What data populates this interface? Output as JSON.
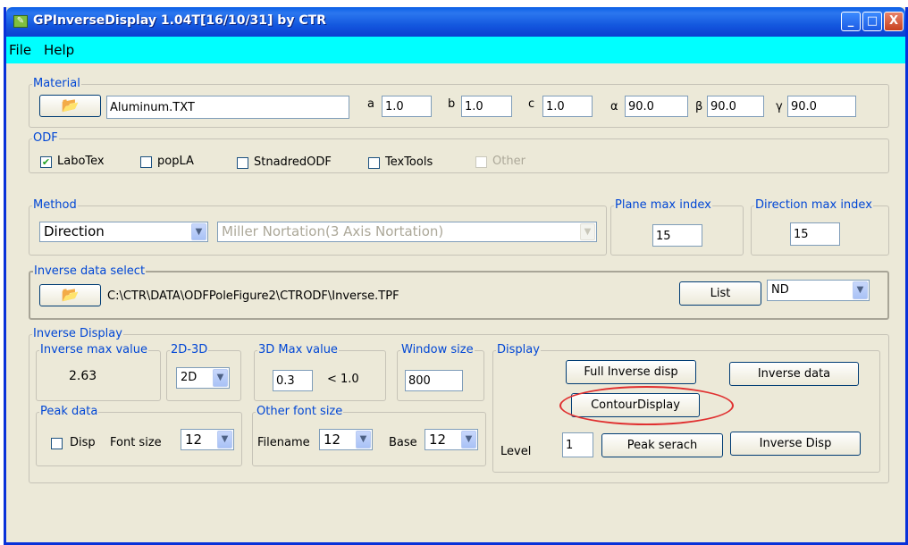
{
  "window": {
    "title": "GPInverseDisplay 1.04T[16/10/31] by CTR",
    "minimize": "_",
    "maximize": "□",
    "close": "X"
  },
  "menu": [
    "File",
    "Help"
  ],
  "material": {
    "legend": "Material",
    "file": "Aluminum.TXT",
    "params": [
      {
        "label": "a",
        "value": "1.0"
      },
      {
        "label": "b",
        "value": "1.0"
      },
      {
        "label": "c",
        "value": "1.0"
      },
      {
        "label": "α",
        "value": "90.0"
      },
      {
        "label": "β",
        "value": "90.0"
      },
      {
        "label": "γ",
        "value": "90.0"
      }
    ]
  },
  "odf": {
    "legend": "ODF",
    "options": [
      {
        "label": "LaboTex",
        "checked": true
      },
      {
        "label": "popLA",
        "checked": false
      },
      {
        "label": "StnadredODF",
        "checked": false
      },
      {
        "label": "TexTools",
        "checked": false
      },
      {
        "label": "Other",
        "checked": false
      }
    ]
  },
  "method": {
    "legend": "Method",
    "selected": "Direction",
    "notation": "Miller Nortation(3 Axis Nortation)"
  },
  "plane_max": {
    "legend": "Plane max index",
    "value": "15"
  },
  "direction_max": {
    "legend": "Direction max index",
    "value": "15"
  },
  "inverse_select": {
    "legend": "Inverse data select",
    "path": "C:\\CTR\\DATA\\ODFPoleFigure2\\CTRODF\\Inverse.TPF",
    "list_button": "List",
    "axis": "ND"
  },
  "inverse_display": {
    "legend": "Inverse Display",
    "max_value": {
      "legend": "Inverse max value",
      "value": "2.63"
    },
    "dim": {
      "legend": "2D-3D",
      "value": "2D"
    },
    "max3d": {
      "legend": "3D Max value",
      "value": "0.3",
      "hint": "< 1.0"
    },
    "window_size": {
      "legend": "Window size",
      "value": "800"
    },
    "peak": {
      "legend": "Peak data",
      "disp_label": "Disp",
      "font_label": "Font size",
      "font_value": "12"
    },
    "other_font": {
      "legend": "Other font size",
      "filename_label": "Filename",
      "filename_value": "12",
      "base_label": "Base",
      "base_value": "12"
    },
    "display": {
      "legend": "Display",
      "full_inverse": "Full Inverse disp",
      "inverse_data": "Inverse data",
      "contour": "ContourDisplay",
      "level_label": "Level",
      "level_value": "1",
      "peak_search": "Peak serach",
      "inverse_disp": "Inverse Disp"
    }
  },
  "highlight_color": "#e03030"
}
